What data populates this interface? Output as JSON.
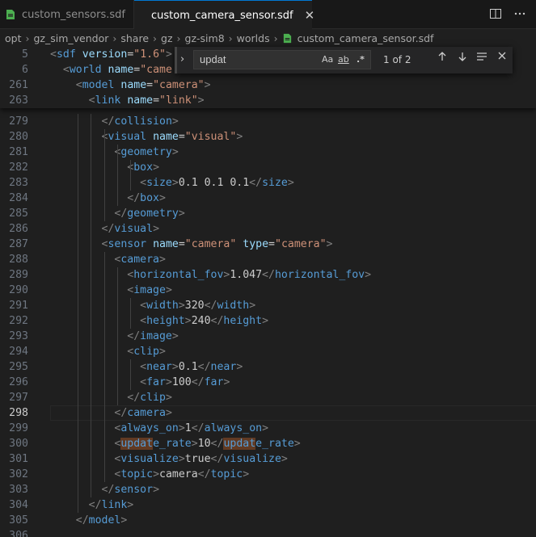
{
  "tabs": [
    {
      "label": "custom_sensors.sdf"
    },
    {
      "label": "custom_camera_sensor.sdf",
      "close": "✕"
    }
  ],
  "breadcrumbs": [
    "opt",
    "gz_sim_vendor",
    "share",
    "gz",
    "gz-sim8",
    "worlds",
    "custom_camera_sensor.sdf"
  ],
  "find": {
    "query": "updat",
    "match_case": "Aa",
    "whole_word": "ab",
    "regex": ".*",
    "count": "1 of 2"
  },
  "sticky_lines": [
    {
      "n": "5",
      "tokens": [
        [
          "brk",
          "<"
        ],
        [
          "tag",
          "sdf"
        ],
        [
          "txt",
          " "
        ],
        [
          "attr",
          "version"
        ],
        [
          "txt",
          "="
        ],
        [
          "str",
          "\"1.6\""
        ],
        [
          "brk",
          ">"
        ]
      ]
    },
    {
      "n": "6",
      "tokens": [
        [
          "txt",
          "  "
        ],
        [
          "brk",
          "<"
        ],
        [
          "tag",
          "world"
        ],
        [
          "txt",
          " "
        ],
        [
          "attr",
          "name"
        ],
        [
          "txt",
          "="
        ],
        [
          "str",
          "\"came"
        ]
      ]
    },
    {
      "n": "261",
      "tokens": [
        [
          "txt",
          "    "
        ],
        [
          "brk",
          "<"
        ],
        [
          "tag",
          "model"
        ],
        [
          "txt",
          " "
        ],
        [
          "attr",
          "name"
        ],
        [
          "txt",
          "="
        ],
        [
          "str",
          "\"camera\""
        ],
        [
          "brk",
          ">"
        ]
      ]
    },
    {
      "n": "263",
      "tokens": [
        [
          "txt",
          "      "
        ],
        [
          "brk",
          "<"
        ],
        [
          "tag",
          "link"
        ],
        [
          "txt",
          " "
        ],
        [
          "attr",
          "name"
        ],
        [
          "txt",
          "="
        ],
        [
          "str",
          "\"link\""
        ],
        [
          "brk",
          ">"
        ]
      ]
    }
  ],
  "lines": [
    {
      "n": "279",
      "tokens": [
        [
          "txt",
          "        "
        ],
        [
          "brk",
          "</"
        ],
        [
          "tag",
          "collision"
        ],
        [
          "brk",
          ">"
        ]
      ]
    },
    {
      "n": "280",
      "tokens": [
        [
          "txt",
          "        "
        ],
        [
          "brk",
          "<"
        ],
        [
          "tag",
          "visual"
        ],
        [
          "txt",
          " "
        ],
        [
          "attr",
          "name"
        ],
        [
          "txt",
          "="
        ],
        [
          "str",
          "\"visual\""
        ],
        [
          "brk",
          ">"
        ]
      ]
    },
    {
      "n": "281",
      "tokens": [
        [
          "txt",
          "          "
        ],
        [
          "brk",
          "<"
        ],
        [
          "tag",
          "geometry"
        ],
        [
          "brk",
          ">"
        ]
      ]
    },
    {
      "n": "282",
      "tokens": [
        [
          "txt",
          "            "
        ],
        [
          "brk",
          "<"
        ],
        [
          "tag",
          "box"
        ],
        [
          "brk",
          ">"
        ]
      ]
    },
    {
      "n": "283",
      "tokens": [
        [
          "txt",
          "              "
        ],
        [
          "brk",
          "<"
        ],
        [
          "tag",
          "size"
        ],
        [
          "brk",
          ">"
        ],
        [
          "txt",
          "0.1 0.1 0.1"
        ],
        [
          "brk",
          "</"
        ],
        [
          "tag",
          "size"
        ],
        [
          "brk",
          ">"
        ]
      ]
    },
    {
      "n": "284",
      "tokens": [
        [
          "txt",
          "            "
        ],
        [
          "brk",
          "</"
        ],
        [
          "tag",
          "box"
        ],
        [
          "brk",
          ">"
        ]
      ]
    },
    {
      "n": "285",
      "tokens": [
        [
          "txt",
          "          "
        ],
        [
          "brk",
          "</"
        ],
        [
          "tag",
          "geometry"
        ],
        [
          "brk",
          ">"
        ]
      ]
    },
    {
      "n": "286",
      "tokens": [
        [
          "txt",
          "        "
        ],
        [
          "brk",
          "</"
        ],
        [
          "tag",
          "visual"
        ],
        [
          "brk",
          ">"
        ]
      ]
    },
    {
      "n": "287",
      "tokens": [
        [
          "txt",
          "        "
        ],
        [
          "brk",
          "<"
        ],
        [
          "tag",
          "sensor"
        ],
        [
          "txt",
          " "
        ],
        [
          "attr",
          "name"
        ],
        [
          "txt",
          "="
        ],
        [
          "str",
          "\"camera\""
        ],
        [
          "txt",
          " "
        ],
        [
          "attr",
          "type"
        ],
        [
          "txt",
          "="
        ],
        [
          "str",
          "\"camera\""
        ],
        [
          "brk",
          ">"
        ]
      ]
    },
    {
      "n": "288",
      "tokens": [
        [
          "txt",
          "          "
        ],
        [
          "brk",
          "<"
        ],
        [
          "tag",
          "camera"
        ],
        [
          "brk",
          ">"
        ]
      ]
    },
    {
      "n": "289",
      "tokens": [
        [
          "txt",
          "            "
        ],
        [
          "brk",
          "<"
        ],
        [
          "tag",
          "horizontal_fov"
        ],
        [
          "brk",
          ">"
        ],
        [
          "txt",
          "1.047"
        ],
        [
          "brk",
          "</"
        ],
        [
          "tag",
          "horizontal_fov"
        ],
        [
          "brk",
          ">"
        ]
      ]
    },
    {
      "n": "290",
      "tokens": [
        [
          "txt",
          "            "
        ],
        [
          "brk",
          "<"
        ],
        [
          "tag",
          "image"
        ],
        [
          "brk",
          ">"
        ]
      ]
    },
    {
      "n": "291",
      "tokens": [
        [
          "txt",
          "              "
        ],
        [
          "brk",
          "<"
        ],
        [
          "tag",
          "width"
        ],
        [
          "brk",
          ">"
        ],
        [
          "txt",
          "320"
        ],
        [
          "brk",
          "</"
        ],
        [
          "tag",
          "width"
        ],
        [
          "brk",
          ">"
        ]
      ]
    },
    {
      "n": "292",
      "tokens": [
        [
          "txt",
          "              "
        ],
        [
          "brk",
          "<"
        ],
        [
          "tag",
          "height"
        ],
        [
          "brk",
          ">"
        ],
        [
          "txt",
          "240"
        ],
        [
          "brk",
          "</"
        ],
        [
          "tag",
          "height"
        ],
        [
          "brk",
          ">"
        ]
      ]
    },
    {
      "n": "293",
      "tokens": [
        [
          "txt",
          "            "
        ],
        [
          "brk",
          "</"
        ],
        [
          "tag",
          "image"
        ],
        [
          "brk",
          ">"
        ]
      ]
    },
    {
      "n": "294",
      "tokens": [
        [
          "txt",
          "            "
        ],
        [
          "brk",
          "<"
        ],
        [
          "tag",
          "clip"
        ],
        [
          "brk",
          ">"
        ]
      ]
    },
    {
      "n": "295",
      "tokens": [
        [
          "txt",
          "              "
        ],
        [
          "brk",
          "<"
        ],
        [
          "tag",
          "near"
        ],
        [
          "brk",
          ">"
        ],
        [
          "txt",
          "0.1"
        ],
        [
          "brk",
          "</"
        ],
        [
          "tag",
          "near"
        ],
        [
          "brk",
          ">"
        ]
      ]
    },
    {
      "n": "296",
      "tokens": [
        [
          "txt",
          "              "
        ],
        [
          "brk",
          "<"
        ],
        [
          "tag",
          "far"
        ],
        [
          "brk",
          ">"
        ],
        [
          "txt",
          "100"
        ],
        [
          "brk",
          "</"
        ],
        [
          "tag",
          "far"
        ],
        [
          "brk",
          ">"
        ]
      ]
    },
    {
      "n": "297",
      "tokens": [
        [
          "txt",
          "            "
        ],
        [
          "brk",
          "</"
        ],
        [
          "tag",
          "clip"
        ],
        [
          "brk",
          ">"
        ]
      ]
    },
    {
      "n": "298",
      "tokens": [
        [
          "txt",
          "          "
        ],
        [
          "brk",
          "</"
        ],
        [
          "tag",
          "camera"
        ],
        [
          "brk",
          ">"
        ]
      ]
    },
    {
      "n": "299",
      "tokens": [
        [
          "txt",
          "          "
        ],
        [
          "brk",
          "<"
        ],
        [
          "tag",
          "always_on"
        ],
        [
          "brk",
          ">"
        ],
        [
          "txt",
          "1"
        ],
        [
          "brk",
          "</"
        ],
        [
          "tag",
          "always_on"
        ],
        [
          "brk",
          ">"
        ]
      ]
    },
    {
      "n": "300",
      "tokens": [
        [
          "txt",
          "          "
        ],
        [
          "brk",
          "<"
        ],
        [
          "hl",
          "updat"
        ],
        [
          "tag",
          "e_rate"
        ],
        [
          "brk",
          ">"
        ],
        [
          "txt",
          "10"
        ],
        [
          "brk",
          "</"
        ],
        [
          "hl",
          "updat"
        ],
        [
          "tag",
          "e_rate"
        ],
        [
          "brk",
          ">"
        ]
      ]
    },
    {
      "n": "301",
      "tokens": [
        [
          "txt",
          "          "
        ],
        [
          "brk",
          "<"
        ],
        [
          "tag",
          "visualize"
        ],
        [
          "brk",
          ">"
        ],
        [
          "txt",
          "true"
        ],
        [
          "brk",
          "</"
        ],
        [
          "tag",
          "visualize"
        ],
        [
          "brk",
          ">"
        ]
      ]
    },
    {
      "n": "302",
      "tokens": [
        [
          "txt",
          "          "
        ],
        [
          "brk",
          "<"
        ],
        [
          "tag",
          "topic"
        ],
        [
          "brk",
          ">"
        ],
        [
          "txt",
          "camera"
        ],
        [
          "brk",
          "</"
        ],
        [
          "tag",
          "topic"
        ],
        [
          "brk",
          ">"
        ]
      ]
    },
    {
      "n": "303",
      "tokens": [
        [
          "txt",
          "        "
        ],
        [
          "brk",
          "</"
        ],
        [
          "tag",
          "sensor"
        ],
        [
          "brk",
          ">"
        ]
      ]
    },
    {
      "n": "304",
      "tokens": [
        [
          "txt",
          "      "
        ],
        [
          "brk",
          "</"
        ],
        [
          "tag",
          "link"
        ],
        [
          "brk",
          ">"
        ]
      ]
    },
    {
      "n": "305",
      "tokens": [
        [
          "txt",
          "    "
        ],
        [
          "brk",
          "</"
        ],
        [
          "tag",
          "model"
        ],
        [
          "brk",
          ">"
        ]
      ]
    },
    {
      "n": "306",
      "tokens": []
    }
  ],
  "active_line": "298",
  "colors": {
    "accent": "#0078d4",
    "match_highlight": "#613a23",
    "sdf_icon": "#4caf50"
  }
}
